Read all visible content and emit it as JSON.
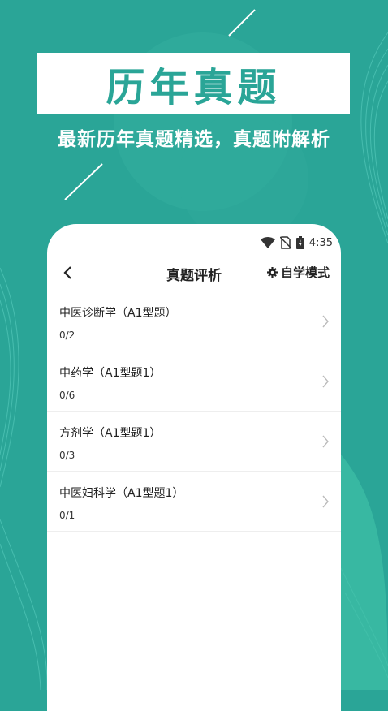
{
  "banner": {
    "title": "历年真题",
    "subtitle": "最新历年真题精选，真题附解析"
  },
  "status_bar": {
    "time": "4:35",
    "icons": [
      "wifi-icon",
      "no-sim-icon",
      "battery-charging-icon"
    ]
  },
  "header": {
    "back_icon": "chevron-left-icon",
    "title": "真题评析",
    "mode_icon": "gear-icon",
    "mode_label": "自学模式"
  },
  "items": [
    {
      "title": "中医诊断学（A1型题）",
      "progress": "0/2"
    },
    {
      "title": "中药学（A1型题1）",
      "progress": "0/6"
    },
    {
      "title": "方剂学（A1型题1）",
      "progress": "0/3"
    },
    {
      "title": "中医妇科学（A1型题1）",
      "progress": "0/1"
    }
  ],
  "colors": {
    "brand": "#2aa597",
    "background": "#2aa597",
    "card": "#ffffff"
  }
}
